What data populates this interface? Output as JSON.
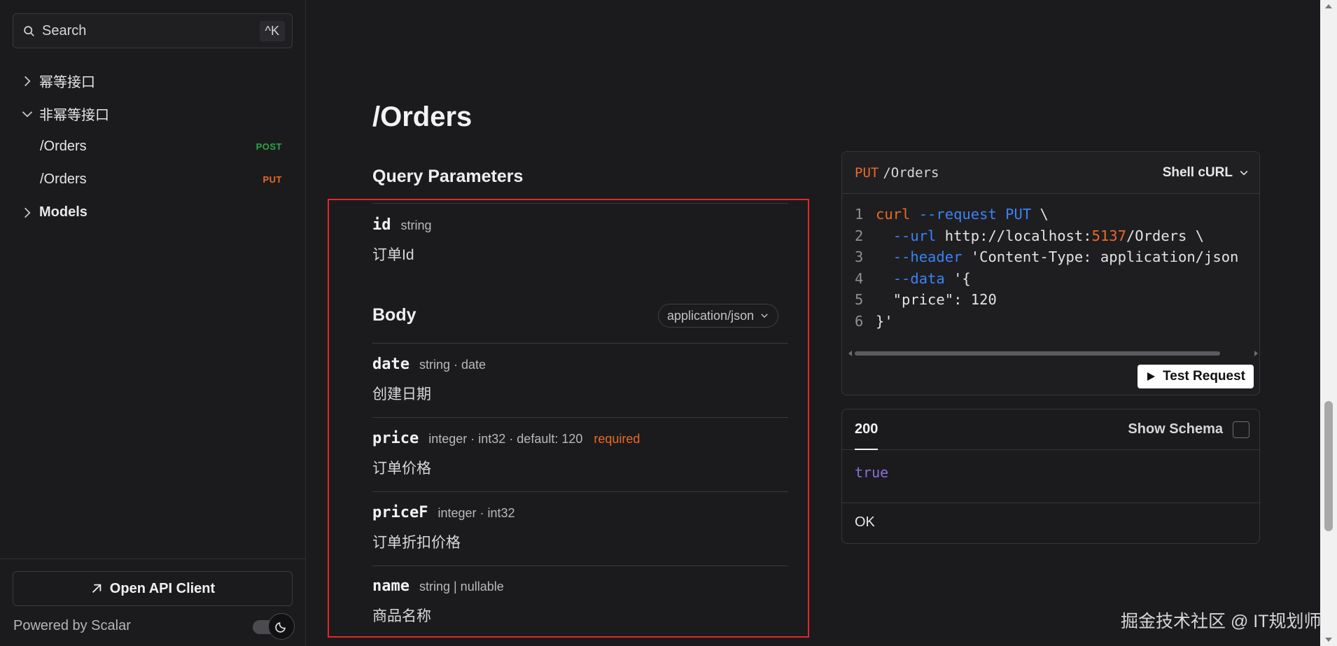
{
  "sidebar": {
    "search": {
      "label": "Search",
      "shortcut": "^K"
    },
    "items": [
      {
        "label": "幂等接口",
        "expanded": false,
        "icon": "chevron-right-icon"
      },
      {
        "label": "非幂等接口",
        "expanded": true,
        "icon": "chevron-down-icon"
      },
      {
        "label": "/Orders",
        "method": "POST"
      },
      {
        "label": "/Orders",
        "method": "PUT"
      },
      {
        "label": "Models",
        "expanded": false,
        "icon": "chevron-right-icon"
      }
    ],
    "open_client_label": "Open API Client",
    "powered_by": "Powered by Scalar",
    "theme": "dark"
  },
  "main": {
    "title": "/Orders",
    "query_section": "Query Parameters",
    "query_params": [
      {
        "name": "id",
        "type": "string",
        "description": "订单Id"
      }
    ],
    "body_section": "Body",
    "content_type": "application/json",
    "body_params": [
      {
        "name": "date",
        "type": "string · date",
        "required": "",
        "description": "创建日期"
      },
      {
        "name": "price",
        "type": "integer · int32 · default: 120",
        "required": "required",
        "description": "订单价格"
      },
      {
        "name": "priceF",
        "type": "integer · int32",
        "required": "",
        "description": "订单折扣价格"
      },
      {
        "name": "name",
        "type": "string | nullable",
        "required": "",
        "description": "商品名称"
      }
    ]
  },
  "request": {
    "method": "PUT",
    "path": "/Orders",
    "language": "Shell cURL",
    "code_lines": [
      {
        "n": "1",
        "parts": [
          [
            "o",
            "curl"
          ],
          [
            "t",
            " "
          ],
          [
            "b",
            "--request"
          ],
          [
            "t",
            " "
          ],
          [
            "b",
            "PUT"
          ],
          [
            "t",
            " \\"
          ]
        ]
      },
      {
        "n": "2",
        "parts": [
          [
            "t",
            "  "
          ],
          [
            "b",
            "--url"
          ],
          [
            "t",
            " http://localhost:"
          ],
          [
            "o",
            "5137"
          ],
          [
            "t",
            "/Orders \\"
          ]
        ]
      },
      {
        "n": "3",
        "parts": [
          [
            "t",
            "  "
          ],
          [
            "b",
            "--header"
          ],
          [
            "t",
            " 'Content-Type: application/json"
          ]
        ]
      },
      {
        "n": "4",
        "parts": [
          [
            "t",
            "  "
          ],
          [
            "b",
            "--data"
          ],
          [
            "t",
            " '{"
          ]
        ]
      },
      {
        "n": "5",
        "parts": [
          [
            "t",
            "  \"price\": 120"
          ]
        ]
      },
      {
        "n": "6",
        "parts": [
          [
            "t",
            "}'"
          ]
        ]
      }
    ],
    "test_button": "Test Request"
  },
  "response": {
    "status_tab": "200",
    "show_schema_label": "Show Schema",
    "body": "true",
    "status_text": "OK"
  },
  "watermark": "掘金技术社区 @ IT规划师",
  "colors": {
    "accent_put": "#ea6a24",
    "accent_post": "#2fa548",
    "highlight_border": "#e3262b",
    "code_keyword": "#3b82f6",
    "response_value": "#8b6fd6"
  }
}
